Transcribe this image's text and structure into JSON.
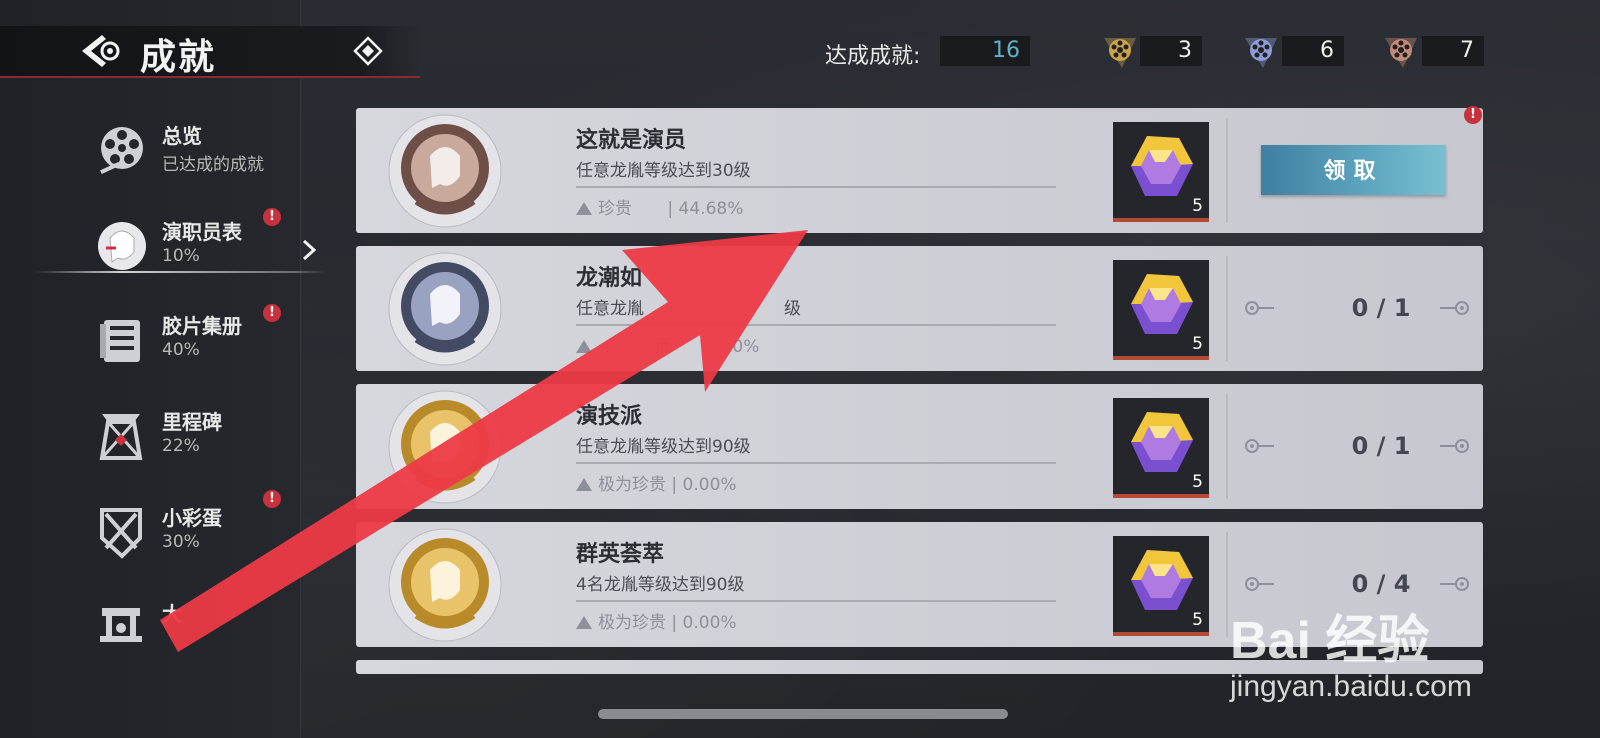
{
  "header": {
    "title": "成就",
    "achieved_label": "达成成就:",
    "achieved_count": "16",
    "stats": [
      {
        "icon": "gold-reel-icon",
        "value": "3",
        "color": "#c9a24a"
      },
      {
        "icon": "silver-reel-icon",
        "value": "6",
        "color": "#8d9bd6"
      },
      {
        "icon": "bronze-reel-icon",
        "value": "7",
        "color": "#c28a78"
      }
    ]
  },
  "sidebar": {
    "items": [
      {
        "label": "总览",
        "sub": "已达成的成就",
        "icon": "film-reel-icon",
        "badge": false
      },
      {
        "label": "演职员表",
        "sub": "10%",
        "icon": "portrait-icon",
        "badge": true,
        "active": true
      },
      {
        "label": "胶片集册",
        "sub": "40%",
        "icon": "book-icon",
        "badge": true
      },
      {
        "label": "里程碑",
        "sub": "22%",
        "icon": "tower-icon",
        "badge": true
      },
      {
        "label": "小彩蛋",
        "sub": "30%",
        "icon": "shield-icon",
        "badge": true
      },
      {
        "label": "大",
        "sub": "",
        "icon": "stage-icon",
        "badge": false
      }
    ],
    "badge_mark": "!"
  },
  "achievements": [
    {
      "title": "这就是演员",
      "desc": "任意龙胤等级达到30级",
      "rarity": "珍贵",
      "rate": "44.68%",
      "reward_count": "5",
      "medal": "bronze",
      "state": "claim",
      "claim_label": "领取",
      "badge": "!"
    },
    {
      "title": "龙潮如",
      "desc": "任意龙胤",
      "rarity": "",
      "rate": "",
      "reward_count": "5",
      "medal": "silver",
      "state": "progress",
      "progress": "0 / 1",
      "desc_tail": "级",
      "rate_tail": "0%",
      "rarity_partial": "贵"
    },
    {
      "title": "演技派",
      "desc": "任意龙胤等级达到90级",
      "rarity": "极为珍贵",
      "rate": "0.00%",
      "reward_count": "5",
      "medal": "gold",
      "state": "progress",
      "progress": "0 / 1"
    },
    {
      "title": "群英荟萃",
      "desc": "4名龙胤等级达到90级",
      "rarity": "极为珍贵",
      "rate": "0.00%",
      "reward_count": "5",
      "medal": "gold",
      "state": "progress",
      "progress": "0 / 4"
    }
  ],
  "watermark": {
    "main": "Bai  经验",
    "sub": "jingyan.baidu.com"
  },
  "colors": {
    "accent_red": "#e8323f",
    "claim_blue": "#5fa7c0",
    "card_bg": "#d6d7dd"
  }
}
